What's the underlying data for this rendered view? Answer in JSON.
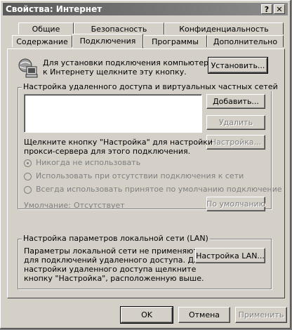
{
  "window": {
    "title": "Свойства: Интернет",
    "help_label": "?",
    "close_label": "✕"
  },
  "tabs": {
    "row1": [
      "Общие",
      "Безопасность",
      "Конфиденциальность"
    ],
    "row2": [
      "Содержание",
      "Подключения",
      "Программы",
      "Дополнительно"
    ],
    "active": "Подключения"
  },
  "setup": {
    "text": [
      "Для установки подключения компьютера",
      "к Интернету щелкните эту кнопку."
    ],
    "button": "Установить..."
  },
  "dialup": {
    "group_label": "Настройка удаленного доступа и виртуальных частных сетей",
    "add_button": "Добавить...",
    "remove_button": "Удалить",
    "settings_button": "Настройка...",
    "hint": [
      "Щелкните кнопку \"Настройка\" для настройки",
      "прокси-сервера для этого подключения."
    ],
    "radios": [
      "Никогда не использовать",
      "Использовать при отсутствии подключения к сети",
      "Всегда использовать принятое по умолчанию подключение"
    ],
    "selected_radio": 0,
    "default_label": "Умолчание:",
    "default_value": "Отсутствует",
    "default_button": "По умолчанию"
  },
  "lan": {
    "group_label": "Настройка параметров локальной сети (LAN)",
    "text": [
      "Параметры локальной сети не применяются",
      "для подключений удаленного доступа. Для",
      "настройки удаленного доступа щелкните",
      "кнопку \"Настройка\", расположенную выше."
    ],
    "button": "Настройка LAN..."
  },
  "footer": {
    "ok": "OK",
    "cancel": "Отмена",
    "apply": "Применить"
  }
}
